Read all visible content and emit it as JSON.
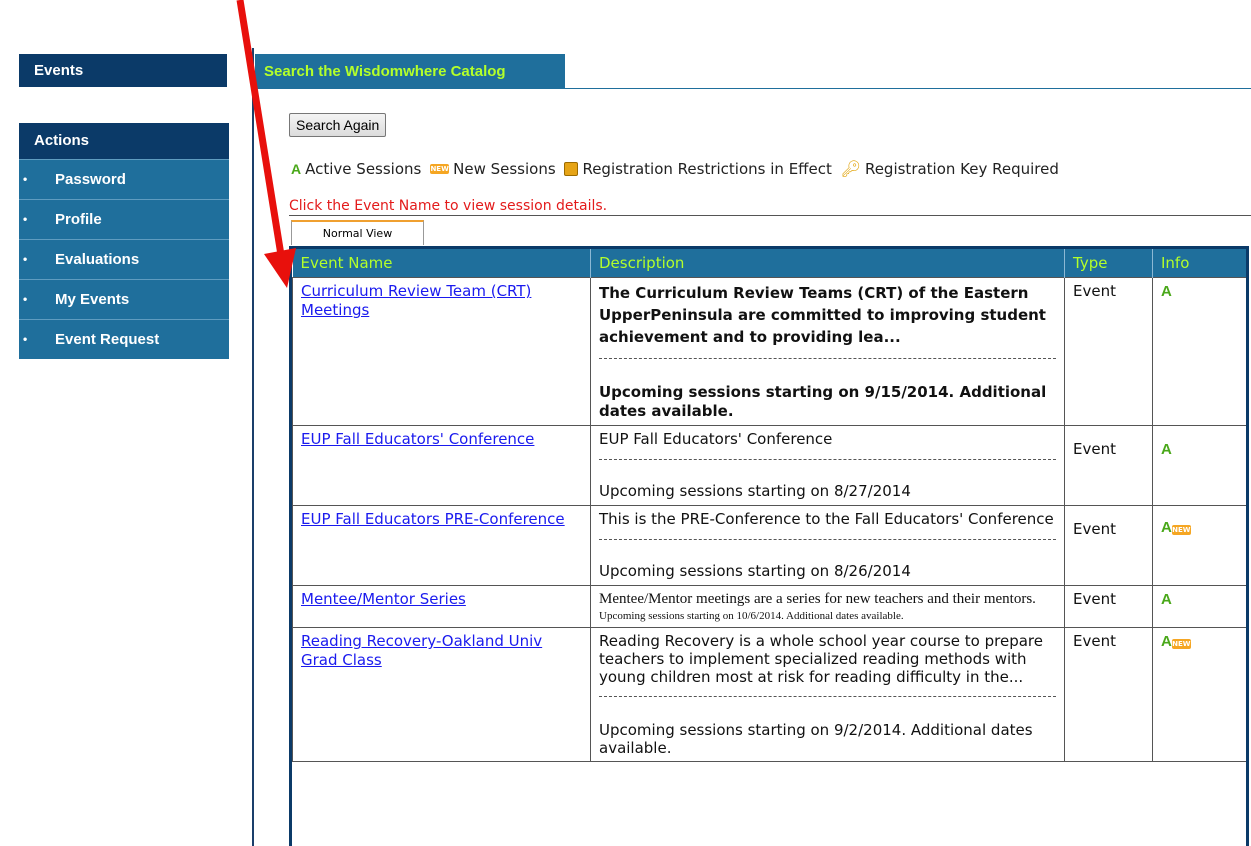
{
  "sidebar": {
    "events_label": "Events",
    "actions_title": "Actions",
    "items": [
      {
        "label": "Password"
      },
      {
        "label": "Profile"
      },
      {
        "label": "Evaluations"
      },
      {
        "label": "My Events"
      },
      {
        "label": "Event Request"
      }
    ]
  },
  "header": {
    "catalog_tab": "Search the Wisdomwhere Catalog"
  },
  "search_again_label": "Search Again",
  "legend": {
    "active": "Active Sessions",
    "new": "New Sessions",
    "restrictions": "Registration Restrictions in Effect",
    "key": "Registration Key Required",
    "new_badge": "NEW",
    "a_glyph": "A"
  },
  "hint": "Click the Event Name to view session details.",
  "view_tab": "Normal View",
  "columns": {
    "name": "Event Name",
    "description": "Description",
    "type": "Type",
    "info": "Info"
  },
  "rows": [
    {
      "name": "Curriculum Review Team (CRT) Meetings",
      "description": "The Curriculum Review Teams (CRT) of the Eastern UpperPeninsula are committed to improving student achievement and to providing lea...",
      "sessions": "Upcoming sessions starting on 9/15/2014. Additional dates available.",
      "type": "Event"
    },
    {
      "name": "EUP Fall Educators' Conference",
      "description": "EUP Fall Educators' Conference",
      "sessions": "Upcoming sessions starting on 8/27/2014",
      "type": "Event"
    },
    {
      "name": "EUP Fall Educators PRE-Conference",
      "description": "This is the PRE-Conference to the Fall Educators' Conference",
      "sessions": "Upcoming sessions starting on 8/26/2014",
      "type": "Event"
    },
    {
      "name": "Mentee/Mentor Series",
      "description": "Mentee/Mentor meetings are a series for new teachers and their mentors.",
      "sessions": "Upcoming sessions starting on 10/6/2014. Additional dates available.",
      "type": "Event"
    },
    {
      "name": "Reading Recovery-Oakland Univ Grad Class",
      "description": "Reading Recovery is a whole school year course to prepare teachers to implement specialized reading methods with young children most at risk for reading difficulty in the...",
      "sessions": "Upcoming sessions starting on 9/2/2014. Additional dates available.",
      "type": "Event"
    }
  ],
  "colors": {
    "sidebar_dark": "#0b3a68",
    "sidebar_item": "#1f6f9c",
    "header_text": "#b4ff2a",
    "hint_red": "#e31b1b",
    "arrow_red": "#e8100c"
  }
}
